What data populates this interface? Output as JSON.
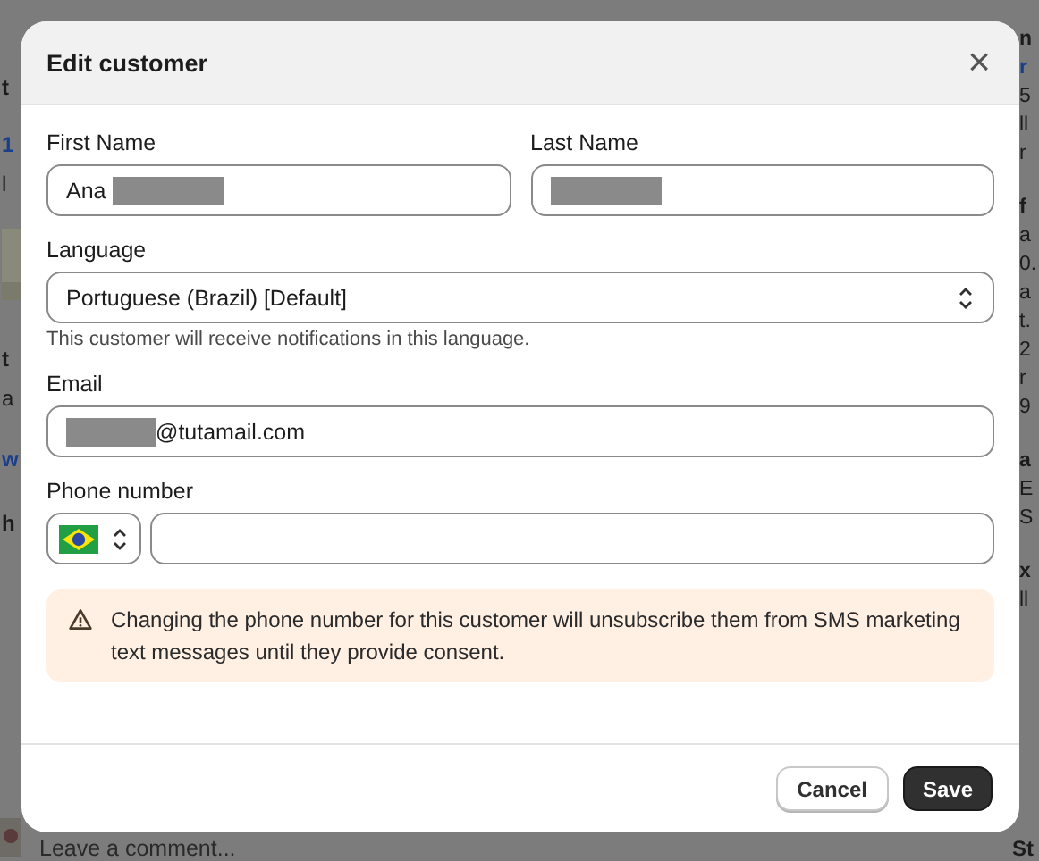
{
  "background": {
    "left": [
      {
        "kind": "bold",
        "text": "t"
      },
      {
        "kind": "link",
        "text": "1"
      },
      {
        "kind": "text",
        "text": "l"
      },
      {
        "kind": "picture"
      },
      {
        "kind": "bold",
        "text": "t"
      },
      {
        "kind": "text",
        "text": "a"
      },
      {
        "kind": "link",
        "text": "w"
      },
      {
        "kind": "bold",
        "text": "h"
      }
    ],
    "right": [
      {
        "kind": "bold",
        "text": "n"
      },
      {
        "kind": "link",
        "text": "r"
      },
      {
        "kind": "text",
        "text": "5"
      },
      {
        "kind": "text",
        "text": "ll"
      },
      {
        "kind": "text",
        "text": "r"
      },
      {
        "kind": "bold",
        "text": "f"
      },
      {
        "kind": "text",
        "text": "a"
      },
      {
        "kind": "text",
        "text": "0."
      },
      {
        "kind": "text",
        "text": "a"
      },
      {
        "kind": "text",
        "text": "t."
      },
      {
        "kind": "text",
        "text": "2"
      },
      {
        "kind": "text",
        "text": "r"
      },
      {
        "kind": "text",
        "text": "9"
      },
      {
        "kind": "bold",
        "text": "a"
      },
      {
        "kind": "text",
        "text": "E"
      },
      {
        "kind": "text",
        "text": "S"
      },
      {
        "kind": "bold",
        "text": "x"
      },
      {
        "kind": "text",
        "text": "ll"
      }
    ],
    "comment_field": {
      "placeholder": "Leave a comment..."
    },
    "store_label": "St"
  },
  "dialog": {
    "title": "Edit customer",
    "close": "×",
    "first_name": {
      "label": "First Name",
      "value": "Ana",
      "redacted": true
    },
    "last_name": {
      "label": "Last Name",
      "redacted": true
    },
    "language": {
      "label": "Language",
      "value": "Portuguese (Brazil) [Default]",
      "help": "This customer will receive notifications in this language."
    },
    "email": {
      "label": "Email",
      "value": "@tutamail.com",
      "redacted": true
    },
    "phone": {
      "label": "Phone number"
    },
    "warning": "Changing the phone number for this customer will unsubscribe them from SMS marketing text messages until they provide consent.",
    "buttons": [
      {
        "label": "Cancel",
        "kind": "secondary"
      },
      {
        "label": "Save",
        "kind": "primary"
      }
    ]
  }
}
